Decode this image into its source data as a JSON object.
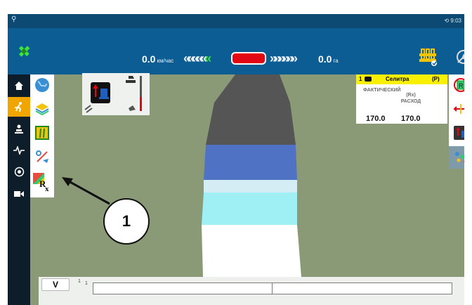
{
  "status_bar": {
    "left_icon": "usb-icon",
    "right_text": "9:03",
    "right_icons": [
      "sync-icon"
    ]
  },
  "top_bar": {
    "gps_icon": "satellite-icon",
    "speed_left_value": "0.0",
    "speed_left_unit": "км/час",
    "speed_right_value": "0.0",
    "speed_right_unit": "га",
    "implement_icon": "implement-icon",
    "compass_icon": "compass-disabled-icon"
  },
  "left_nav": [
    {
      "name": "home",
      "icon": "home-icon"
    },
    {
      "name": "run",
      "icon": "run-icon",
      "active": true
    },
    {
      "name": "machine",
      "icon": "machine-icon"
    },
    {
      "name": "diagnostics",
      "icon": "pulse-icon"
    },
    {
      "name": "settings",
      "icon": "settings-icon"
    },
    {
      "name": "camera",
      "icon": "video-icon"
    }
  ],
  "layers": [
    {
      "name": "globe",
      "icon": "globe-icon"
    },
    {
      "name": "layers",
      "icon": "layers-icon"
    },
    {
      "name": "guidance",
      "icon": "guidance-icon"
    },
    {
      "name": "percent",
      "icon": "percent-icon"
    },
    {
      "name": "rx-map",
      "icon": "rx-map-icon",
      "label": "Rx"
    }
  ],
  "product_panel": {
    "number": "1",
    "name": "Селитра",
    "mode": "(P)",
    "actual_label": "ФАКТИЧЕСКИЙ",
    "rx_label": "(Rx) РАСХОД",
    "actual_value": "170.0",
    "rx_value": "170.0"
  },
  "right_tools": [
    {
      "name": "steering",
      "icon": "steering-icon"
    },
    {
      "name": "shift",
      "icon": "shift-icon"
    },
    {
      "name": "tractor",
      "icon": "tractor-icon"
    },
    {
      "name": "swath",
      "icon": "swath-icon"
    }
  ],
  "bottom_bar": {
    "v_label": "V",
    "pass_number": "1",
    "pass_value": "1"
  },
  "nav_bar": {
    "icons": [
      "shield-icon",
      "back-icon",
      "home-icon",
      "recents-icon",
      "screenshot-icon"
    ]
  },
  "callout": {
    "label": "1"
  }
}
